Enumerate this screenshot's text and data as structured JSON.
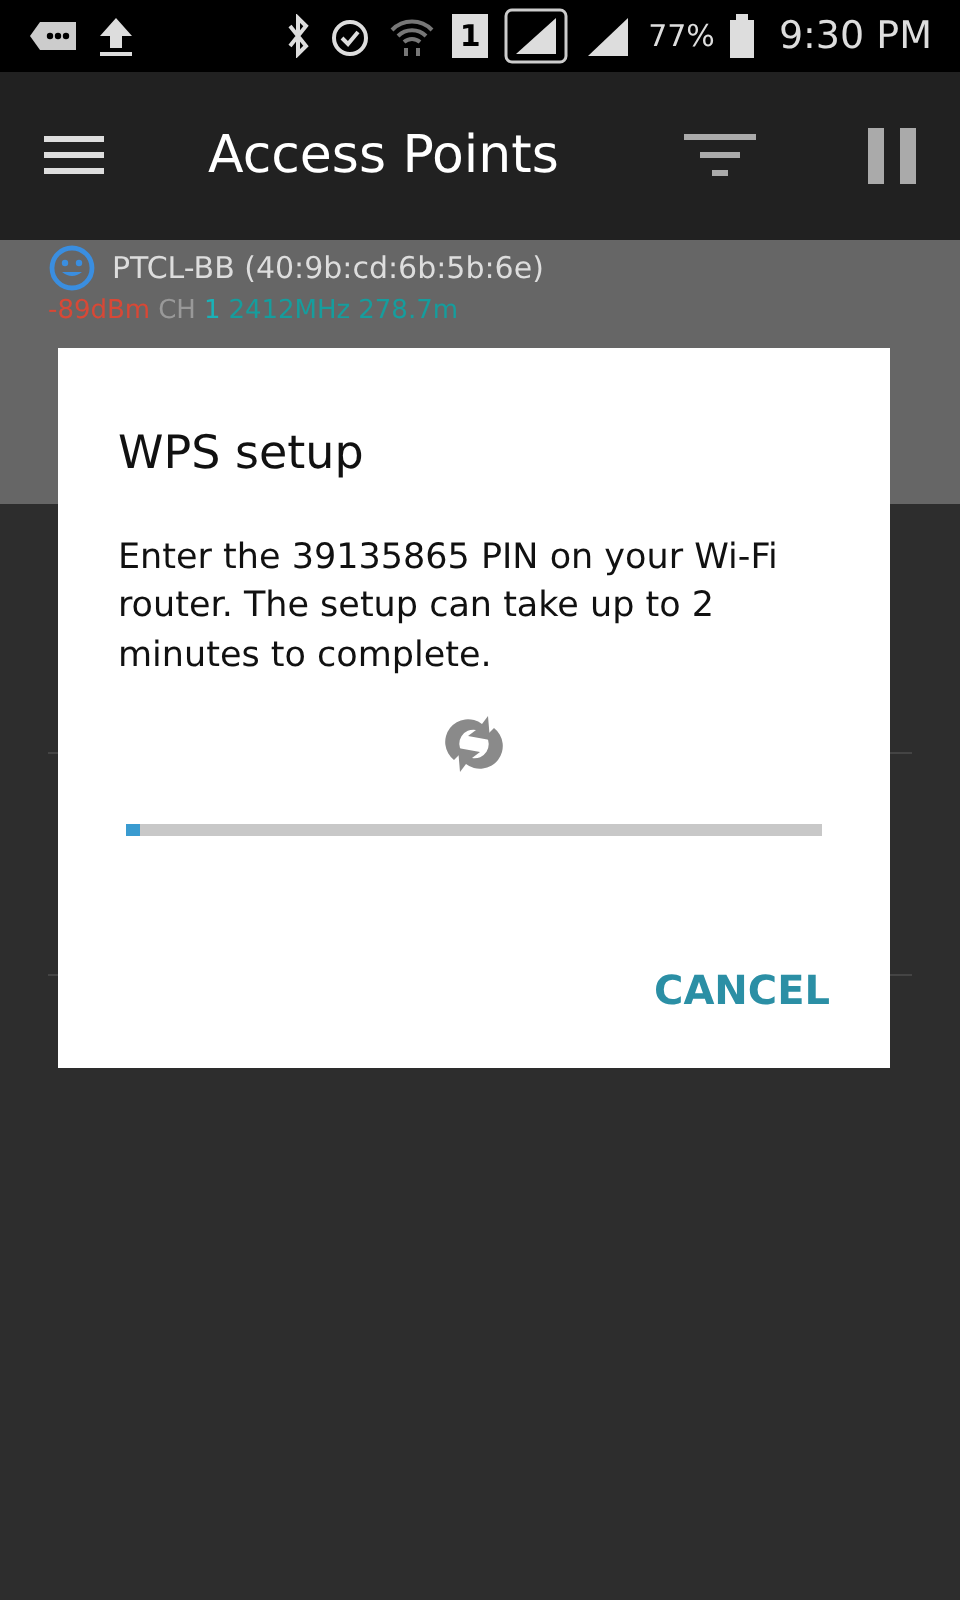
{
  "status_bar": {
    "sim_slot": "1",
    "battery_percent": "77%",
    "time": "9:30 PM"
  },
  "toolbar": {
    "title": "Access Points"
  },
  "access_points": [
    {
      "name": "PTCL-BB (40:9b:cd:6b:5b:6e)",
      "signal": "-89dBm",
      "channel_label": "CH",
      "channel": "1",
      "frequency": "2412MHz",
      "distance": "278.7m",
      "selected": true
    }
  ],
  "dialog": {
    "title": "WPS setup",
    "message": "Enter the 39135865 PIN on your Wi-Fi router. The setup can take up to 2 minutes to complete.",
    "progress": {
      "level": 0.02
    },
    "buttons": [
      "CANCEL"
    ]
  }
}
